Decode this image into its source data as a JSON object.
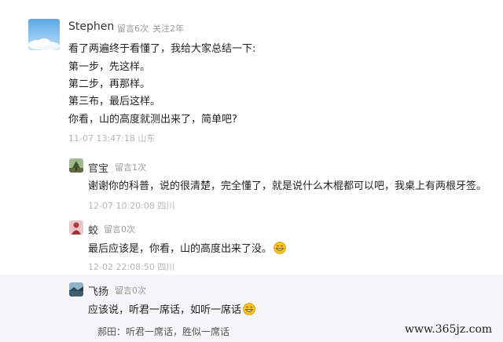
{
  "main_comment": {
    "author": "Stephen",
    "comment_count": "留言6次",
    "follow_info": "关注2年",
    "lines": [
      "看了两遍终于看懂了，我给大家总结一下:",
      "第一步，先这样。",
      "第二步，再那样。",
      "第三布，最后这样。",
      "你看，山的高度就测出来了，简单吧?"
    ],
    "timestamp": "11-07 13:47:18 山东"
  },
  "replies": [
    {
      "author": "官宝",
      "comment_count": "留言1次",
      "text": "谢谢你的科普，说的很清楚，完全懂了，就是说什么木棍都可以吧，我桌上有两根牙签。",
      "timestamp": "12-07 10:20:08 四川"
    },
    {
      "author": "蛟",
      "comment_count": "留言0次",
      "text": "最后应该是，你看，山的高度出来了没。",
      "timestamp": "12-02 22:08:50 四川"
    },
    {
      "author": "飞扬",
      "comment_count": "留言0次",
      "text": "应该说，听君一席话，如听一席话",
      "sub_reply": "郝田：听君一席话，胜似一席话"
    }
  ],
  "watermark": "www.365jz.com",
  "icons": {
    "main_avatar": "sky-avatar-icon",
    "reply1_avatar": "tree-avatar-icon",
    "reply2_avatar": "figure-avatar-icon",
    "reply3_avatar": "landscape-avatar-icon",
    "emoji": "grin-emoji-icon"
  }
}
